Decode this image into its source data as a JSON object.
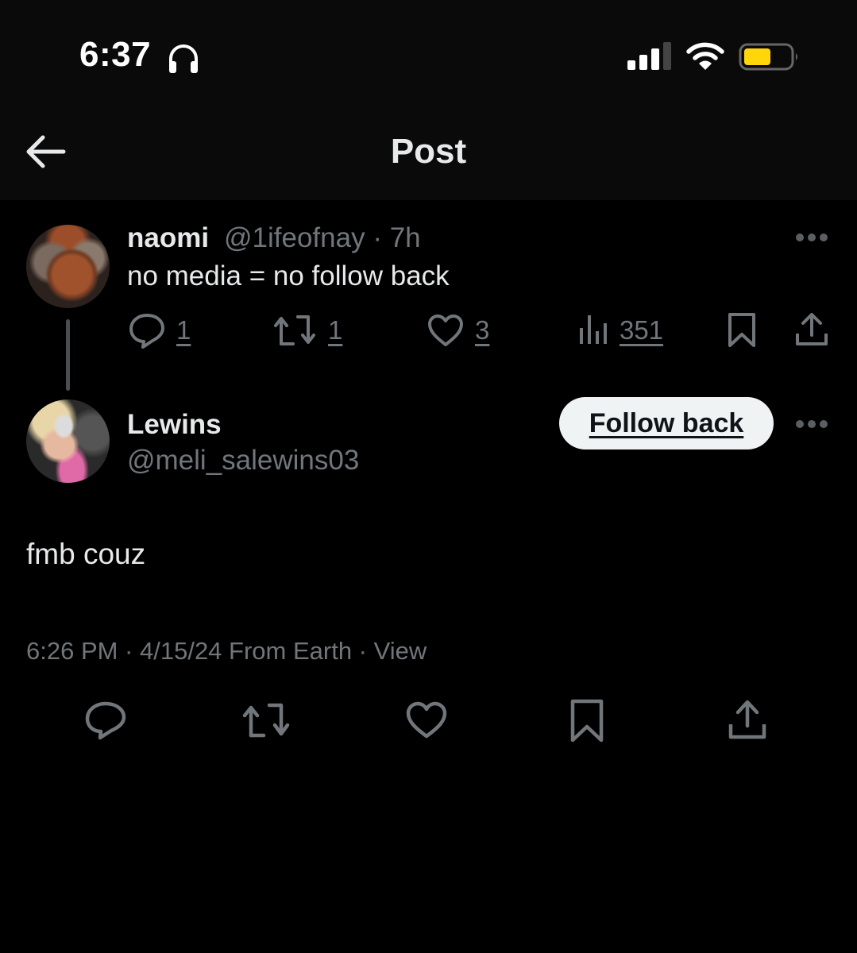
{
  "status_bar": {
    "time": "6:37",
    "icons": [
      "headphones-icon",
      "signal-icon",
      "wifi-icon",
      "battery-icon"
    ],
    "signal_bars": 3,
    "signal_bars_total": 4,
    "battery_level_percent": 55,
    "battery_color": "#ffd60a"
  },
  "header": {
    "back_icon": "arrow-left-icon",
    "title": "Post"
  },
  "parent_post": {
    "display_name": "naomi",
    "handle": "@1ifeofnay",
    "time_ago": "· 7h",
    "text": "no media = no follow back",
    "more_icon": "ellipsis-icon",
    "actions": {
      "replies": "1",
      "reposts": "1",
      "likes": "3",
      "views": "351"
    }
  },
  "reply_post": {
    "display_name": "Lewins",
    "handle": "@meli_salewins03",
    "follow_button": "Follow back",
    "more_icon": "ellipsis-icon",
    "text": "fmb couz",
    "timestamp": "6:26 PM · 4/15/24 From Earth · View"
  },
  "bottom_actions": [
    "reply-icon",
    "repost-icon",
    "like-icon",
    "bookmark-icon",
    "share-icon"
  ],
  "colors": {
    "background": "#000000",
    "header_background": "#0a0a0a",
    "primary_text": "#e7e9ea",
    "secondary_text": "#71767b",
    "icon_gray": "#71767b",
    "button_bg": "#eff3f4"
  }
}
